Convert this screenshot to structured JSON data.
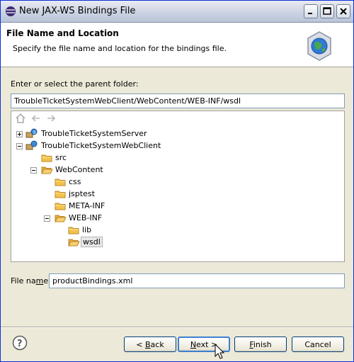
{
  "window": {
    "title": "New JAX-WS Bindings File"
  },
  "banner": {
    "title": "File Name and Location",
    "subtitle": "Specify the file name and location for the bindings file."
  },
  "folder": {
    "label": "Enter or select the parent folder:",
    "value": "TroubleTicketSystemWebClient/WebContent/WEB-INF/wsdl"
  },
  "tree": {
    "items": [
      {
        "label": "TroubleTicketSystemServer",
        "icon": "web-project-icon",
        "expanded": false
      },
      {
        "label": "TroubleTicketSystemWebClient",
        "icon": "web-project-icon",
        "expanded": true
      },
      {
        "label": "src",
        "icon": "folder-icon"
      },
      {
        "label": "WebContent",
        "icon": "folder-icon",
        "expanded": true
      },
      {
        "label": "css",
        "icon": "folder-icon"
      },
      {
        "label": "jsptest",
        "icon": "folder-icon"
      },
      {
        "label": "META-INF",
        "icon": "folder-icon"
      },
      {
        "label": "WEB-INF",
        "icon": "folder-icon",
        "expanded": true
      },
      {
        "label": "lib",
        "icon": "folder-icon"
      },
      {
        "label": "wsdl",
        "icon": "folder-icon",
        "selected": true
      }
    ]
  },
  "filename": {
    "label_pre": "File na",
    "label_mn": "m",
    "label_post": "e:",
    "value": "productBindings.xml"
  },
  "buttons": {
    "back_pre": "< ",
    "back_mn": "B",
    "back_post": "ack",
    "next_mn": "N",
    "next_post": "ext >",
    "finish_mn": "F",
    "finish_post": "inish",
    "cancel": "Cancel"
  },
  "colors": {
    "accent": "#0831d9",
    "folder": "#f5c24a",
    "selection": "#e8e8e8"
  }
}
